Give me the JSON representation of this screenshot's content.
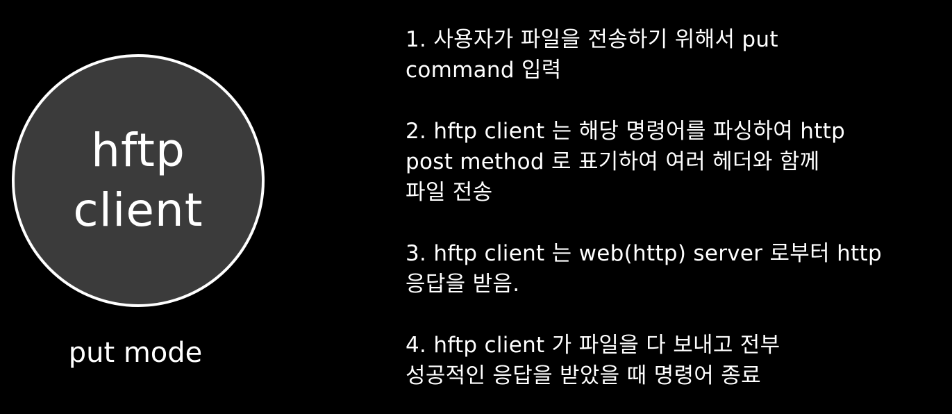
{
  "node": {
    "label_lines": [
      "hftp",
      "client"
    ],
    "fill_color": "#3b3b3b",
    "border_color": "#ffffff"
  },
  "mode_label": "put mode",
  "steps": [
    {
      "lines": [
        "1. 사용자가 파일을 전송하기 위해서 put",
        "command 입력"
      ]
    },
    {
      "lines": [
        "2. hftp client 는 해당 명령어를 파싱하여 http",
        "post method 로 표기하여 여러 헤더와 함께",
        "파일 전송"
      ]
    },
    {
      "lines": [
        "3. hftp client 는 web(http) server 로부터 http",
        "응답을 받음."
      ]
    },
    {
      "lines": [
        "4. hftp client 가 파일을 다 보내고 전부",
        "성공적인 응답을 받았을 때 명령어 종료"
      ]
    }
  ]
}
